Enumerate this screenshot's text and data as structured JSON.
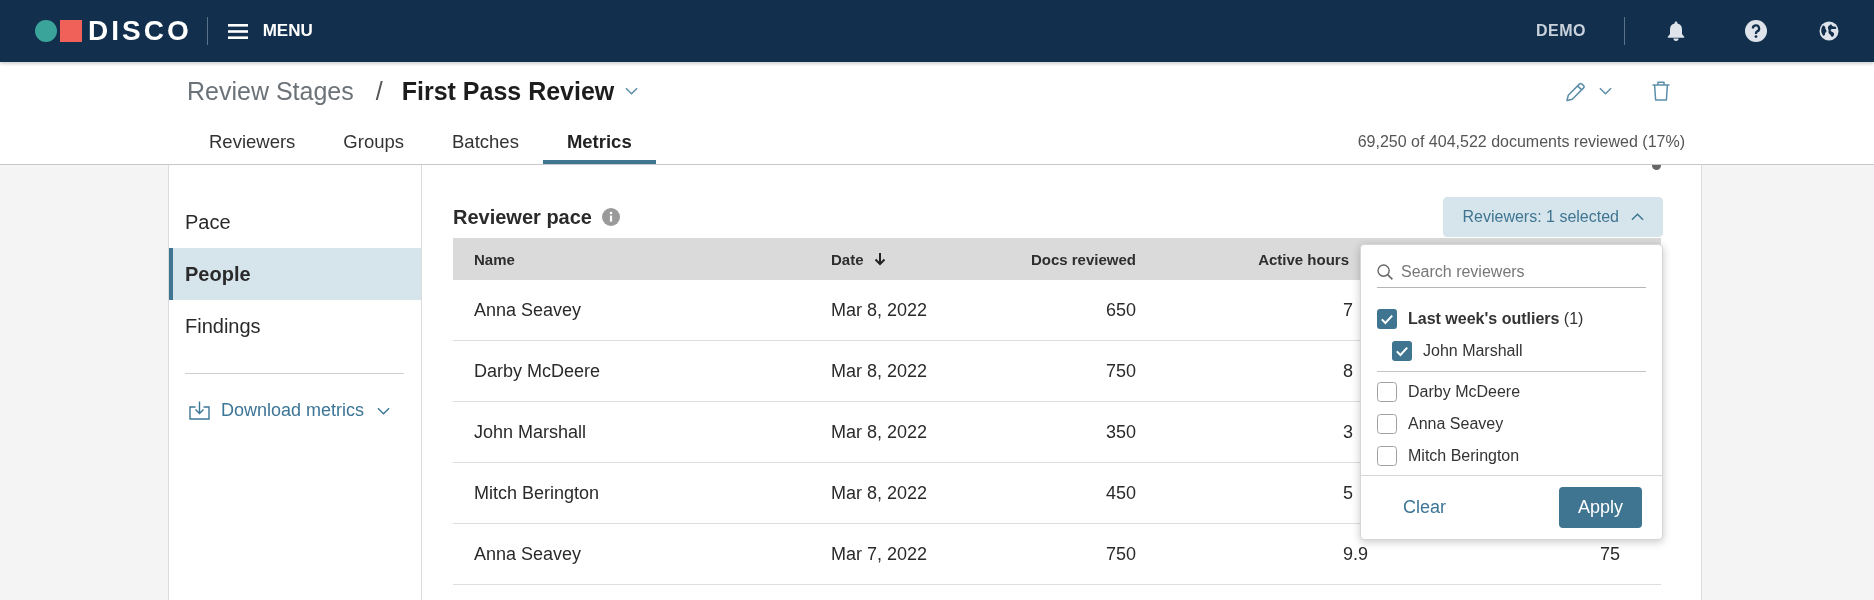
{
  "topbar": {
    "logo": "DISCO",
    "menu": "MENU",
    "workspace": "DEMO"
  },
  "breadcrumb": {
    "parent": "Review Stages",
    "separator": "/",
    "current": "First Pass Review"
  },
  "tabs": [
    {
      "label": "Reviewers",
      "selected": false
    },
    {
      "label": "Groups",
      "selected": false
    },
    {
      "label": "Batches",
      "selected": false
    },
    {
      "label": "Metrics",
      "selected": true
    }
  ],
  "progress_summary": "69,250 of 404,522 documents reviewed (17%)",
  "sidebar": {
    "items": [
      {
        "label": "Pace",
        "selected": false
      },
      {
        "label": "People",
        "selected": true
      },
      {
        "label": "Findings",
        "selected": false
      }
    ],
    "download": "Download metrics"
  },
  "section": {
    "title": "Reviewer pace"
  },
  "table": {
    "columns": [
      {
        "label": "Name",
        "sorted": false
      },
      {
        "label": "Date",
        "sorted": true
      },
      {
        "label": "Docs reviewed",
        "sorted": false
      },
      {
        "label": "Active hours",
        "sorted": false
      }
    ],
    "rows": [
      [
        "Anna Seavey",
        "Mar 8, 2022",
        "650",
        "7"
      ],
      [
        "Darby McDeere",
        "Mar 8, 2022",
        "750",
        "8"
      ],
      [
        "John Marshall",
        "Mar 8, 2022",
        "350",
        "3"
      ],
      [
        "Mitch Berington",
        "Mar 8, 2022",
        "450",
        "5"
      ],
      [
        "Anna Seavey",
        "Mar 7, 2022",
        "750",
        "9.9",
        "75"
      ]
    ]
  },
  "filter": {
    "label": "Reviewers: 1 selected",
    "expanded": true,
    "search": {
      "placeholder": "Search reviewers"
    },
    "groups": [
      {
        "label": "**Last week's outliers** (1)",
        "checked": true,
        "children": [
          {
            "label": "John Marshall",
            "checked": true
          }
        ]
      }
    ],
    "options": [
      {
        "label": "Darby McDeere",
        "checked": false
      },
      {
        "label": "Anna Seavey",
        "checked": false
      },
      {
        "label": "Mitch Berington",
        "checked": false
      }
    ],
    "clear": "Clear",
    "apply": "Apply"
  }
}
